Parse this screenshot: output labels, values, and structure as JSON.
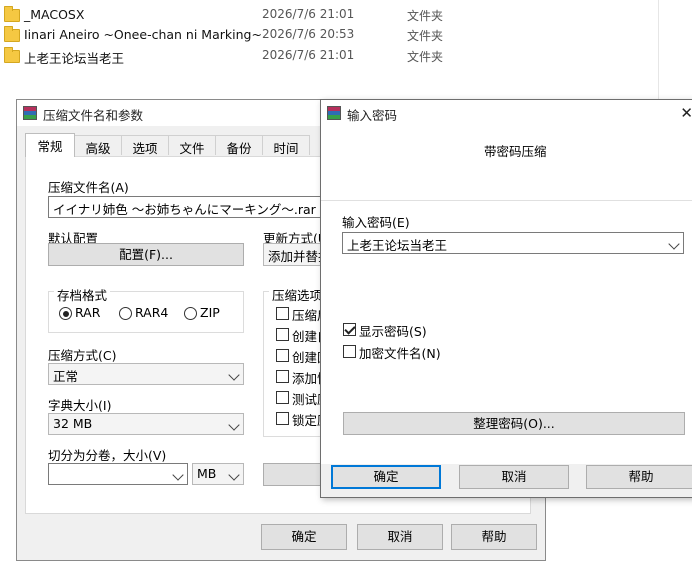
{
  "explorer": {
    "rows": [
      {
        "name": "_MACOSX",
        "date": "2026/7/6 21:01",
        "type": "文件夹"
      },
      {
        "name": "Iinari Aneiro ~Onee-chan ni Marking~",
        "date": "2026/7/6 20:53",
        "type": "文件夹"
      },
      {
        "name": "上老王论坛当老王",
        "date": "2026/7/6 21:01",
        "type": "文件夹"
      }
    ]
  },
  "main_dialog": {
    "title": "压缩文件名和参数",
    "tabs": [
      "常规",
      "高级",
      "选项",
      "文件",
      "备份",
      "时间"
    ],
    "archive_name_label": "压缩文件名(A)",
    "archive_name_value": "イイナリ姉色 ～お姉ちゃんにマーキング～.rar",
    "default_profile_label": "默认配置",
    "profile_button": "配置(F)...",
    "update_mode_label": "更新方式(U",
    "update_mode_value": "添加并替换",
    "format_group_label": "存档格式",
    "formats": [
      {
        "label": "RAR",
        "selected": true
      },
      {
        "label": "RAR4",
        "selected": false
      },
      {
        "label": "ZIP",
        "selected": false
      }
    ],
    "options_group_label": "压缩选项",
    "options": [
      "压缩后",
      "创建自",
      "创建固",
      "添加恢",
      "测试压",
      "锁定压"
    ],
    "method_label": "压缩方式(C)",
    "method_value": "正常",
    "dict_label": "字典大小(I)",
    "dict_value": "32 MB",
    "split_label": "切分为分卷，大小(V)",
    "split_value": "",
    "split_unit": "MB",
    "buttons": {
      "ok": "确定",
      "cancel": "取消",
      "help": "帮助"
    }
  },
  "password_dialog": {
    "title": "输入密码",
    "heading": "带密码压缩",
    "password_label": "输入密码(E)",
    "password_value": "上老王论坛当老王",
    "show_password_label": "显示密码(S)",
    "show_password_checked": true,
    "encrypt_names_label": "加密文件名(N)",
    "encrypt_names_checked": false,
    "organize_button": "整理密码(O)...",
    "buttons": {
      "ok": "确定",
      "cancel": "取消",
      "help": "帮助"
    }
  }
}
